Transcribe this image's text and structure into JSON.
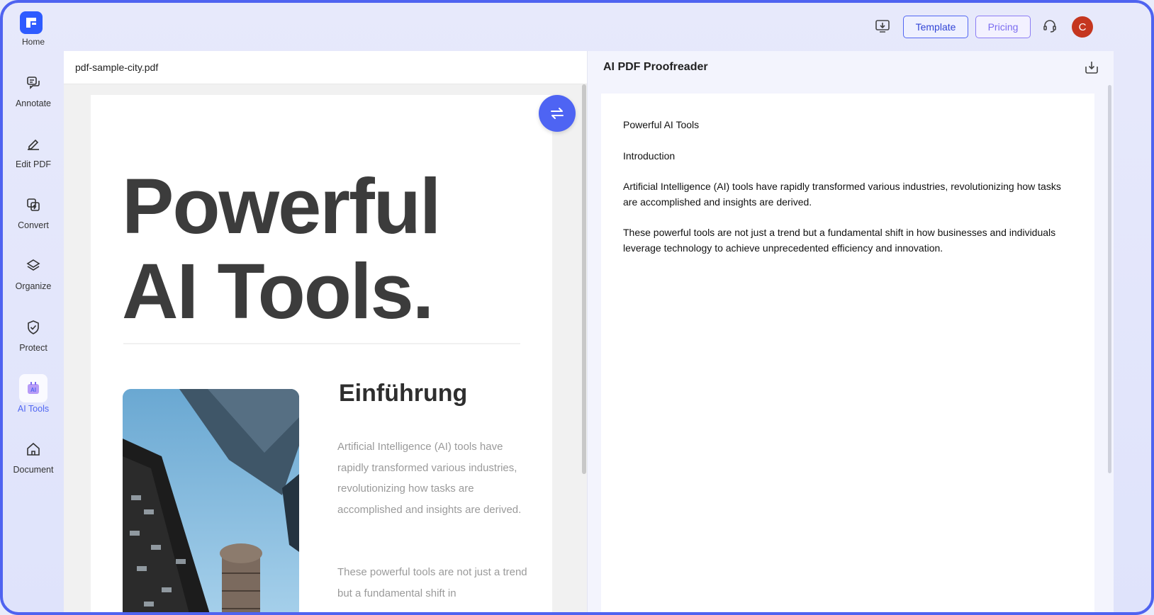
{
  "sidebar": {
    "home_label": "Home",
    "items": [
      {
        "label": "Annotate"
      },
      {
        "label": "Edit PDF"
      },
      {
        "label": "Convert"
      },
      {
        "label": "Organize"
      },
      {
        "label": "Protect"
      },
      {
        "label": "AI Tools",
        "active": true
      },
      {
        "label": "Document"
      }
    ]
  },
  "topbar": {
    "template_label": "Template",
    "pricing_label": "Pricing",
    "avatar_initial": "C"
  },
  "pdf": {
    "filename": "pdf-sample-city.pdf",
    "title_line1": "Powerful",
    "title_line2": "AI Tools.",
    "section_heading": "Einführung",
    "para1": "Artificial Intelligence (AI) tools have rapidly transformed various industries, revolutionizing how tasks are accomplished and insights are derived.",
    "para2": "These powerful tools are not just a trend but a fundamental shift in"
  },
  "proofreader": {
    "title": "AI PDF Proofreader",
    "lines": [
      "Powerful AI Tools",
      "Introduction",
      "Artificial Intelligence (AI) tools have rapidly transformed various industries, revolutionizing how tasks are accomplished and insights are derived.",
      "These powerful tools are not just a trend but a fundamental shift in how businesses and individuals leverage technology to achieve unprecedented efficiency and innovation."
    ]
  },
  "colors": {
    "accent": "#5166f2",
    "avatar": "#c5361f"
  }
}
